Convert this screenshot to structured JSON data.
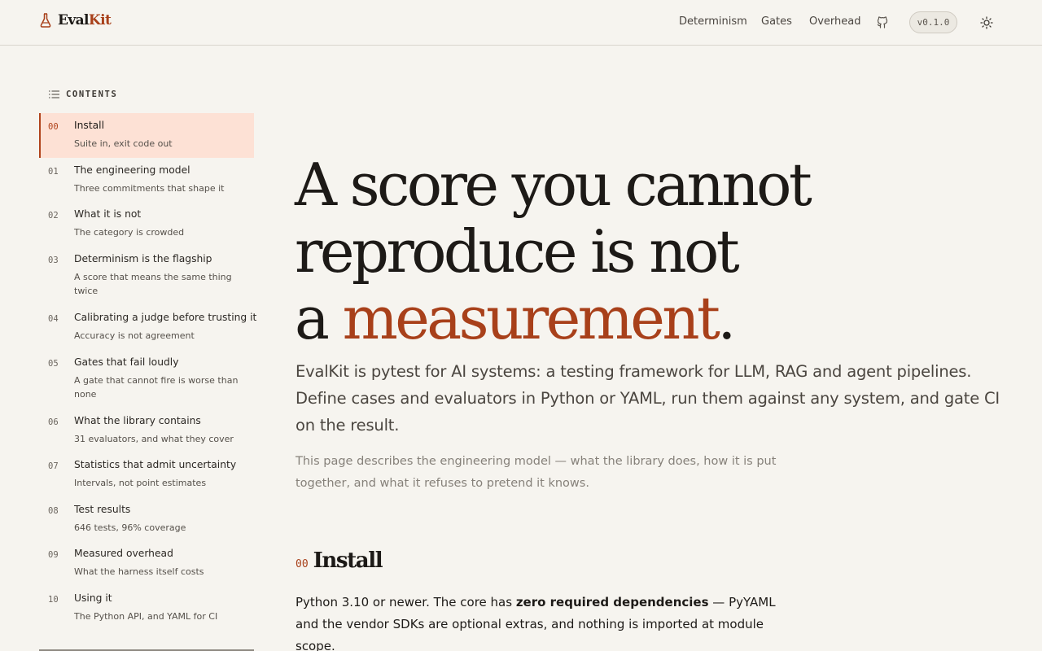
{
  "header": {
    "logo_prefix": "Eval",
    "logo_accent": "Kit",
    "nav": [
      "Determinism",
      "Gates",
      "Overhead"
    ],
    "version": "v0.1.0",
    "icons": {
      "logo": "flask-icon",
      "github": "github-icon",
      "theme": "sun-icon"
    }
  },
  "sidebar": {
    "heading": "CONTENTS",
    "items": [
      {
        "num": "00",
        "title": "Install",
        "subtitle": "Suite in, exit code out",
        "active": true
      },
      {
        "num": "01",
        "title": "The engineering model",
        "subtitle": "Three commitments that shape it"
      },
      {
        "num": "02",
        "title": "What it is not",
        "subtitle": "The category is crowded"
      },
      {
        "num": "03",
        "title": "Determinism is the flagship",
        "subtitle": "A score that means the same thing twice"
      },
      {
        "num": "04",
        "title": "Calibrating a judge before trusting it",
        "subtitle": "Accuracy is not agreement"
      },
      {
        "num": "05",
        "title": "Gates that fail loudly",
        "subtitle": "A gate that cannot fire is worse than none"
      },
      {
        "num": "06",
        "title": "What the library contains",
        "subtitle": "31 evaluators, and what they cover"
      },
      {
        "num": "07",
        "title": "Statistics that admit uncertainty",
        "subtitle": "Intervals, not point estimates"
      },
      {
        "num": "08",
        "title": "Test results",
        "subtitle": "646 tests, 96% coverage"
      },
      {
        "num": "09",
        "title": "Measured overhead",
        "subtitle": "What the harness itself costs"
      },
      {
        "num": "10",
        "title": "Using it",
        "subtitle": "The Python API, and YAML for CI"
      }
    ]
  },
  "hero": {
    "line1": "A score you cannot",
    "line2": "reproduce is not",
    "line3_prefix": "a ",
    "line3_accent": "measurement",
    "line3_suffix": "."
  },
  "lead": "EvalKit is pytest for AI systems: a testing framework for LLM, RAG and agent pipelines. Define cases and evaluators in Python or YAML, run them against any system, and gate CI on the result.",
  "sublead": "This page describes the engineering model — what the library does, how it is put together, and what it refuses to pretend it knows.",
  "install": {
    "num": "00",
    "title": "Install",
    "text_before": "Python 3.10 or newer. The core has ",
    "text_bold": "zero required dependencies",
    "text_after": " — PyYAML and the vendor SDKs are optional extras, and nothing is imported at module scope."
  },
  "colors": {
    "accent": "#a8401a",
    "background": "#f6f4ef",
    "active_bg": "#fde1d5"
  }
}
